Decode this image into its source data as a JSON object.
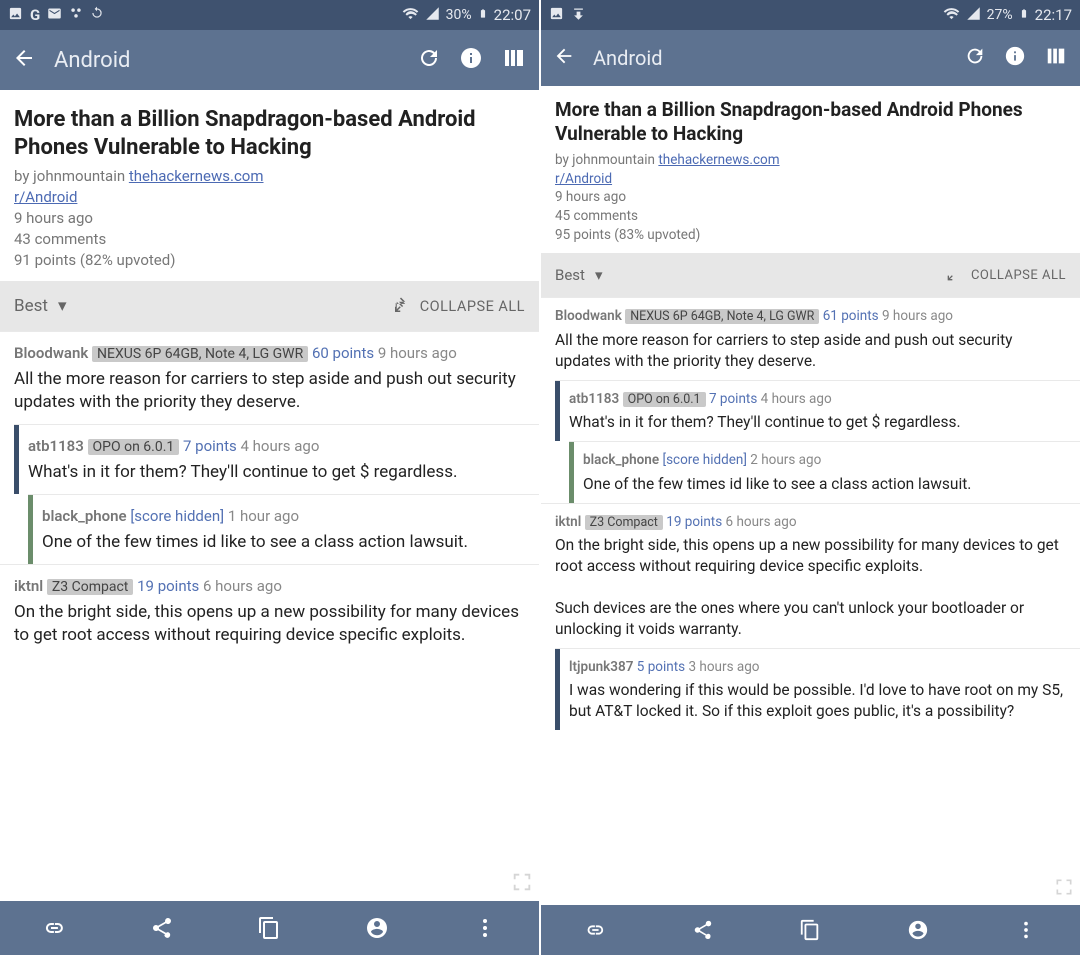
{
  "left": {
    "status": {
      "battery": "30%",
      "time": "22:07"
    },
    "appbar_title": "Android",
    "post": {
      "title": "More than a Billion Snapdragon-based Android Phones Vulnerable to Hacking",
      "by_prefix": "by ",
      "author": "johnmountain",
      "source": "thehackernews.com",
      "subreddit": "r/Android",
      "age": "9 hours ago",
      "comments": "43 comments",
      "points": "91 points (82% upvoted)"
    },
    "sort": {
      "label": "Best",
      "collapse": "COLLAPSE ALL"
    },
    "comments": [
      {
        "depth": 0,
        "user": "Bloodwank",
        "flair": "NEXUS 6P 64GB, Note 4, LG GWR",
        "points": "60 points",
        "age": "9 hours ago",
        "body": "All the more reason for carriers to step aside and push out security updates with the priority they deserve."
      },
      {
        "depth": 1,
        "user": "atb1183",
        "flair": "OPO on 6.0.1",
        "points": "7 points",
        "age": "4 hours ago",
        "body": "What's in it for them? They'll continue to get $ regardless."
      },
      {
        "depth": 2,
        "user": "black_phone",
        "flair": "",
        "score_hidden": "[score hidden]",
        "age": "1 hour ago",
        "body": "One of the few times id like to see a class action lawsuit."
      },
      {
        "depth": 0,
        "user": "iktnl",
        "flair": "Z3 Compact",
        "points": "19 points",
        "age": "6 hours ago",
        "body": "On the bright side, this opens up a new possibility for many devices to get root access without requiring device specific exploits."
      }
    ]
  },
  "right": {
    "status": {
      "battery": "27%",
      "time": "22:17"
    },
    "appbar_title": "Android",
    "post": {
      "title": "More than a Billion Snapdragon-based Android Phones Vulnerable to Hacking",
      "by_prefix": "by ",
      "author": "johnmountain",
      "source": "thehackernews.com",
      "subreddit": "r/Android",
      "age": "9 hours ago",
      "comments": "45 comments",
      "points": "95 points (83% upvoted)"
    },
    "sort": {
      "label": "Best",
      "collapse": "COLLAPSE ALL"
    },
    "comments": [
      {
        "depth": 0,
        "user": "Bloodwank",
        "flair": "NEXUS 6P 64GB, Note 4, LG GWR",
        "points": "61 points",
        "age": "9 hours ago",
        "body": "All the more reason for carriers to step aside and push out security updates with the priority they deserve."
      },
      {
        "depth": 1,
        "user": "atb1183",
        "flair": "OPO on 6.0.1",
        "points": "7 points",
        "age": "4 hours ago",
        "body": "What's in it for them? They'll continue to get $ regardless."
      },
      {
        "depth": 2,
        "user": "black_phone",
        "flair": "",
        "score_hidden": "[score hidden]",
        "age": "2 hours ago",
        "body": "One of the few times id like to see a class action lawsuit."
      },
      {
        "depth": 0,
        "user": "iktnl",
        "flair": "Z3 Compact",
        "points": "19 points",
        "age": "6 hours ago",
        "body": "On the bright side, this opens up a new possibility for many devices to get root access without requiring device specific exploits.\n\nSuch devices are the ones where you can't unlock your bootloader or unlocking it voids warranty."
      },
      {
        "depth": 1,
        "user": "ltjpunk387",
        "flair": "",
        "points": "5 points",
        "age": "3 hours ago",
        "body": "I was wondering if this would be possible. I'd love to have root on my S5, but AT&T locked it. So if this exploit goes public, it's a possibility?"
      }
    ]
  }
}
